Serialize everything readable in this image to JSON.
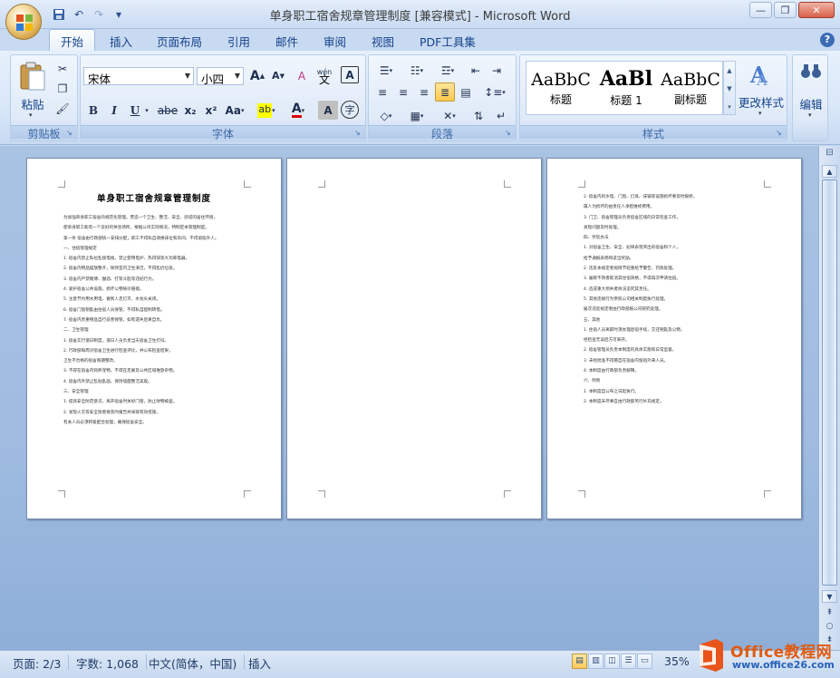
{
  "window": {
    "title": "单身职工宿舍规章管理制度 [兼容模式] - Microsoft Word",
    "minimize": "—",
    "restore": "❐",
    "close": "✕"
  },
  "qat": {
    "save": "💾",
    "undo": "↶",
    "redo": "↷",
    "customize": "▾"
  },
  "tabs": [
    {
      "label": "开始",
      "active": true
    },
    {
      "label": "插入"
    },
    {
      "label": "页面布局"
    },
    {
      "label": "引用"
    },
    {
      "label": "邮件"
    },
    {
      "label": "审阅"
    },
    {
      "label": "视图"
    },
    {
      "label": "PDF工具集"
    }
  ],
  "help": "?",
  "ribbon": {
    "clipboard": {
      "label": "剪贴板",
      "paste": "粘贴"
    },
    "font": {
      "label": "字体",
      "font_name": "宋体",
      "font_size": "小四",
      "bold": "B",
      "italic": "I",
      "underline": "U",
      "strike": "abe",
      "subscript": "x₂",
      "superscript": "x²",
      "change_case": "Aa",
      "highlight": "ab",
      "font_color": "A",
      "char_shading": "A",
      "enclose": "字",
      "grow": "A",
      "shrink": "A",
      "clear": "A",
      "phonetic": "wén",
      "border": "A"
    },
    "paragraph": {
      "label": "段落"
    },
    "styles": {
      "label": "样式",
      "items": [
        {
          "sample": "AaBbC",
          "name": "标题"
        },
        {
          "sample": "AaBl",
          "name": "标题 1"
        },
        {
          "sample": "AaBbC",
          "name": "副标题"
        }
      ],
      "change_styles": "更改样式"
    },
    "editing": {
      "label": "编辑"
    }
  },
  "pages": [
    {
      "title": "单身职工宿舍规章管理制度",
      "lines": [
        "为加强单身职工宿舍的规范化管理，营造一个卫生、整洁、安全、舒适的居住环境，",
        "使单身职工能有一个良好的休息场所，根据公司实际情况，特制定本管理制度。",
        "第一条 宿舍由行政部统一安排分配，职工不得私自调换床位和房间，不得留宿外人。",
        "一、住宿管理规定",
        "1. 宿舍内禁止私拉乱接电线，禁止使用电炉、热得快等大功率电器。",
        "2. 宿舍内物品摆放整齐，保持室内卫生清洁，不得乱扔垃圾。",
        "3. 宿舍内严禁赌博、酗酒、打架斗殴等违纪行为。",
        "4. 爱护宿舍公共设施，损坏公物按价赔偿。",
        "5. 注意节约用水用电，做到人走灯灭、水龙头关闭。",
        "6. 宿舍门窗钥匙由住宿人员保管，不得私自配制转借。",
        "7. 宿舍内贵重物品自行妥善保管，如有遗失后果自负。",
        "二、卫生管理",
        "1. 宿舍实行值日制度，值日人员负责当天宿舍卫生打扫。",
        "2. 行政部每周对宿舍卫生进行检查评比，并公布检查结果，",
        "卫生不合格的宿舍限期整改。",
        "3. 不得在宿舍内饲养宠物，不得在走廊及公共区域堆放杂物。",
        "4. 宿舍内外禁止乱贴乱画，保持墙面整洁美观。",
        "三、安全管理",
        "1. 提高安全防范意识，离开宿舍时关好门窗，防止财物被盗。",
        "2. 发现火灾等安全隐患要及时报告并采取有效措施，",
        "有关人员必须积极配合处理，确保宿舍安全。"
      ]
    },
    {
      "title": "",
      "lines": []
    },
    {
      "title": "",
      "lines": [
        "2. 宿舍内的水电、门窗、灯具、床铺等设施损坏要及时报修，",
        "属人为损坏的由责任人承担维修费用。",
        "3. 门卫、宿舍管理员负责宿舍区域的日常巡查工作，",
        "发现问题及时处理。",
        "四、奖惩办法",
        "1. 对宿舍卫生、安全、纪律表现突出的宿舍和个人，",
        "给予通报表扬和适当奖励。",
        "2. 违反本规定者视情节轻重给予警告、罚款处理。",
        "3. 屡教不改者取消其住宿资格，不得再次申请住宿。",
        "4. 造成重大损失者依法追究其责任。",
        "5. 其他违规行为参照公司相关制度执行处理，",
        "屡次违反规定者由行政部报公司研究处理。",
        "五、其他",
        "1. 住宿人员离职时须办理退宿手续，交还钥匙及公物，",
        "经检查无误后方可离开。",
        "2. 宿舍管理员负责本制度的具体实施和日常监督。",
        "3. 未经批准不得擅自在宿舍内留宿外来人员。",
        "4. 本制度由行政部负责解释。",
        "六、附则",
        "1. 本制度自公布之日起执行。",
        "2. 本制度未尽事宜由行政部另行补充规定。"
      ]
    }
  ],
  "status": {
    "page": "页面: 2/3",
    "words": "字数: 1,068",
    "language": "中文(简体，中国)",
    "mode": "插入",
    "zoom": "35%"
  },
  "watermark": {
    "line1": "Office教程网",
    "line2": "www.office26.com"
  },
  "colors": {
    "ribbon_bg": "#dfeaf8",
    "accent": "#15428b",
    "doc_bg": "#9fbbe0",
    "watermark_orange": "#e05a10"
  }
}
